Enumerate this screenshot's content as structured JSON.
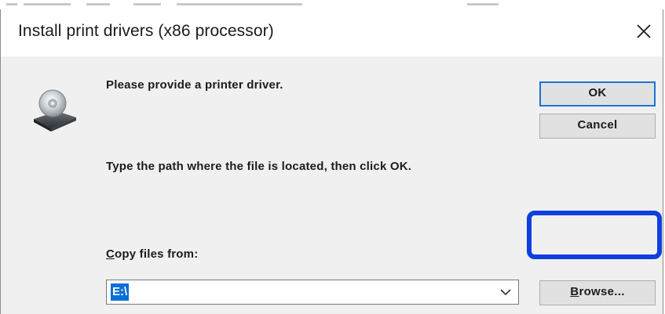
{
  "dialog": {
    "title": "Install print drivers (x86 processor)",
    "close_symbol": "✕",
    "icon": "disk-drive-icon",
    "prompt": "Please provide a printer driver.",
    "instruction": "Type the path where the file is located, then click OK.",
    "copy_label": "Copy files from:",
    "copy_accesskey": "C",
    "copy_value": "E:\\",
    "ok_label": "OK",
    "cancel_label": "Cancel",
    "browse_label": "Browse...",
    "browse_accesskey": "B"
  },
  "colors": {
    "dialog_bg": "#f0f0f0",
    "default_button_border": "#1e72d6",
    "selection": "#0a6fd8",
    "highlight_ring": "#0f3fe0"
  }
}
